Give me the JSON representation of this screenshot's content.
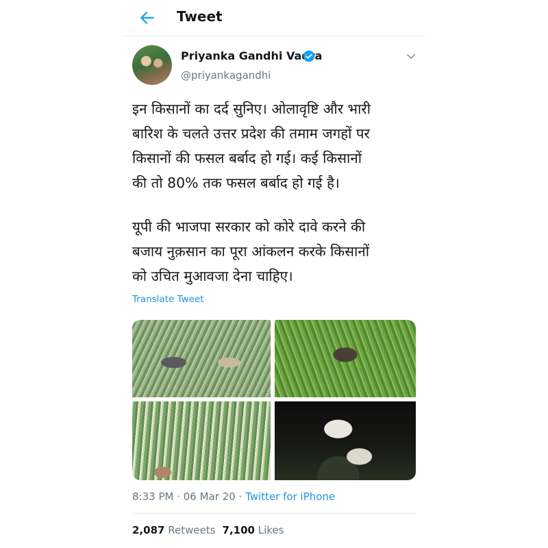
{
  "header": {
    "title": "Tweet"
  },
  "author": {
    "name": "Priyanka Gandhi Vadra",
    "handle": "@priyankagandhi",
    "verified": true
  },
  "tweet": {
    "paragraphs": [
      "इन किसानों का दर्द सुनिए। ओलावृष्टि और भारी\nबारिश के चलते उत्तर प्रदेश की तमाम जगहों पर\nकिसानों की फसल बर्बाद हो गई। कई किसानों\nकी तो 80% तक फसल बर्बाद हो गई है।",
      "यूपी की भाजपा सरकार को कोरे दावे करने की\nबजाय नुक़सान का पूरा आंकलन करके किसानों\nको उचित मुआवजा देना चाहिए।"
    ],
    "translate_label": "Translate Tweet"
  },
  "meta": {
    "time": "8:33 PM",
    "sep1": " · ",
    "date": "06 Mar 20",
    "sep2": " · ",
    "source": "Twitter for iPhone"
  },
  "stats": {
    "retweets_count": "2,087",
    "retweets_label": "Retweets",
    "likes_count": "7,100",
    "likes_label": "Likes"
  },
  "colors": {
    "accent": "#1da1f2",
    "link": "#1b95e0",
    "text": "#14171a",
    "muted": "#657786"
  },
  "icons": {
    "back": "back-arrow-icon",
    "verified": "verified-badge-icon",
    "more": "chevron-down-icon"
  }
}
